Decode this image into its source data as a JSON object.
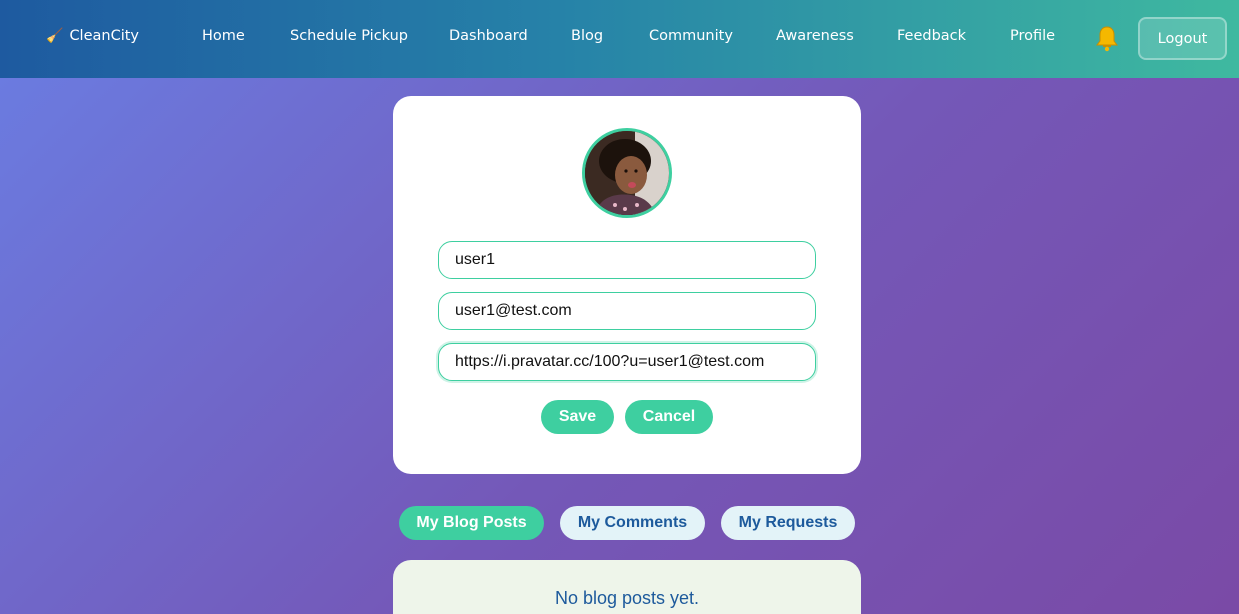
{
  "nav": {
    "brand_icon": "🧹",
    "brand": "CleanCity",
    "links": [
      "Home",
      "Schedule Pickup",
      "Dashboard",
      "Blog",
      "Community",
      "Awareness",
      "Feedback",
      "Profile"
    ],
    "notification_icon": "bell-icon",
    "logout_label": "Logout"
  },
  "profile": {
    "avatar_icon": "avatar",
    "username": "user1",
    "email": "user1@test.com",
    "avatar_url": "https://i.pravatar.cc/100?u=user1@test.com",
    "save_label": "Save",
    "cancel_label": "Cancel"
  },
  "tabs": [
    {
      "label": "My Blog Posts",
      "active": true
    },
    {
      "label": "My Comments",
      "active": false
    },
    {
      "label": "My Requests",
      "active": false
    }
  ],
  "posts": {
    "empty_message": "No blog posts yet."
  },
  "colors": {
    "accent": "#3ecfa0",
    "link_blue": "#1d5a9c",
    "nav_start": "#1e5aa0",
    "nav_end": "#3fb9a0"
  }
}
